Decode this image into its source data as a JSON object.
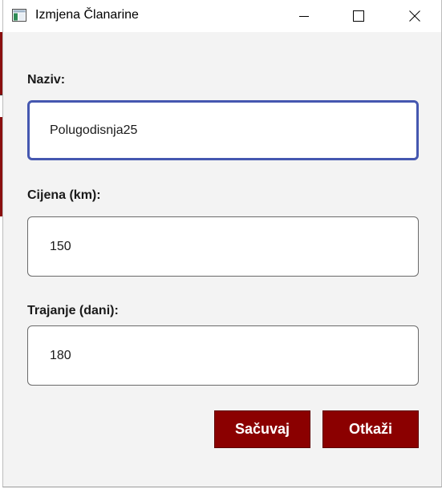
{
  "window": {
    "title": "Izmjena Članarine",
    "controls": {
      "minimize": "minimize-icon",
      "maximize": "maximize-icon",
      "close": "close-icon"
    }
  },
  "form": {
    "naziv": {
      "label": "Naziv:",
      "value": "Polugodisnja25"
    },
    "cijena": {
      "label": "Cijena (km):",
      "value": "150"
    },
    "trajanje": {
      "label": "Trajanje (dani):",
      "value": "180"
    }
  },
  "buttons": {
    "save": "Sačuvaj",
    "cancel": "Otkaži"
  },
  "colors": {
    "accent": "#8b0000",
    "focus_border": "#4557b0",
    "background": "#f3f3f3"
  }
}
